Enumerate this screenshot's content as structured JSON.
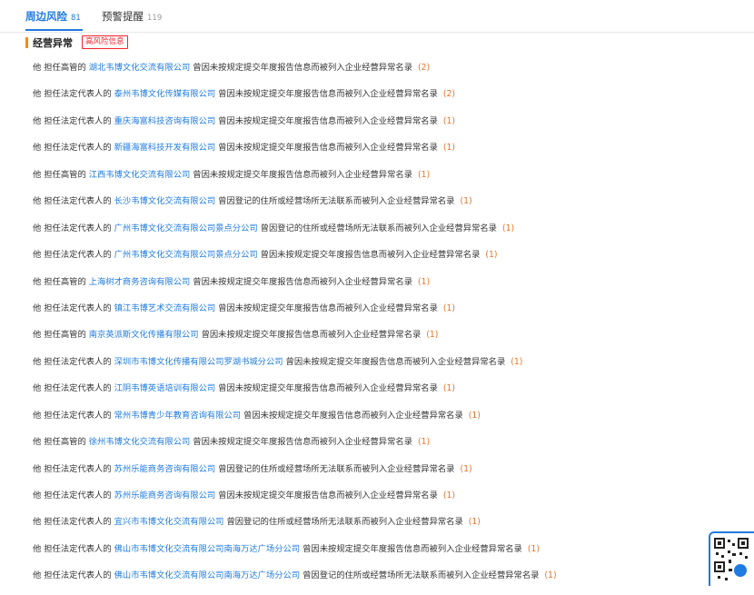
{
  "tabs": [
    {
      "label": "周边风险",
      "count": "81"
    },
    {
      "label": "预警提醒",
      "count": "119"
    }
  ],
  "section": {
    "title": "经营异常",
    "badge": "高风险信息"
  },
  "items": [
    {
      "prefix": "他 担任高管的",
      "company": "湖北韦博文化交流有限公司",
      "desc": "曾因未按规定提交年度报告信息而被列入企业经营异常名录",
      "count": "(2)"
    },
    {
      "prefix": "他 担任法定代表人的",
      "company": "泰州韦博文化传媒有限公司",
      "desc": "曾因未按规定提交年度报告信息而被列入企业经营异常名录",
      "count": "(2)"
    },
    {
      "prefix": "他 担任法定代表人的",
      "company": "重庆海富科技咨询有限公司",
      "desc": "曾因未按规定提交年度报告信息而被列入企业经营异常名录",
      "count": "(1)"
    },
    {
      "prefix": "他 担任法定代表人的",
      "company": "新疆海富科技开发有限公司",
      "desc": "曾因未按规定提交年度报告信息而被列入企业经营异常名录",
      "count": "(1)"
    },
    {
      "prefix": "他 担任高管的",
      "company": "江西韦博文化交流有限公司",
      "desc": "曾因未按规定提交年度报告信息而被列入企业经营异常名录",
      "count": "(1)"
    },
    {
      "prefix": "他 担任法定代表人的",
      "company": "长沙韦博文化交流有限公司",
      "desc": "曾因登记的住所或经营场所无法联系而被列入企业经营异常名录",
      "count": "(1)"
    },
    {
      "prefix": "他 担任法定代表人的",
      "company": "广州韦博文化交流有限公司景点分公司",
      "desc": "曾因登记的住所或经营场所无法联系而被列入企业经营异常名录",
      "count": "(1)"
    },
    {
      "prefix": "他 担任法定代表人的",
      "company": "广州韦博文化交流有限公司景点分公司",
      "desc": "曾因未按规定提交年度报告信息而被列入企业经营异常名录",
      "count": "(1)"
    },
    {
      "prefix": "他 担任高管的",
      "company": "上海树才商务咨询有限公司",
      "desc": "曾因未按规定提交年度报告信息而被列入企业经营异常名录",
      "count": "(1)"
    },
    {
      "prefix": "他 担任法定代表人的",
      "company": "镇江韦博艺术交流有限公司",
      "desc": "曾因未按规定提交年度报告信息而被列入企业经营异常名录",
      "count": "(1)"
    },
    {
      "prefix": "他 担任高管的",
      "company": "南京英派斯文化传播有限公司",
      "desc": "曾因未按规定提交年度报告信息而被列入企业经营异常名录",
      "count": "(1)"
    },
    {
      "prefix": "他 担任法定代表人的",
      "company": "深圳市韦博文化传播有限公司罗湖书城分公司",
      "desc": "曾因未按规定提交年度报告信息而被列入企业经营异常名录",
      "count": "(1)"
    },
    {
      "prefix": "他 担任法定代表人的",
      "company": "江阴韦博英语培训有限公司",
      "desc": "曾因未按规定提交年度报告信息而被列入企业经营异常名录",
      "count": "(1)"
    },
    {
      "prefix": "他 担任法定代表人的",
      "company": "常州韦博青少年教育咨询有限公司",
      "desc": "曾因未按规定提交年度报告信息而被列入企业经营异常名录",
      "count": "(1)"
    },
    {
      "prefix": "他 担任高管的",
      "company": "徐州韦博文化交流有限公司",
      "desc": "曾因未按规定提交年度报告信息而被列入企业经营异常名录",
      "count": "(1)"
    },
    {
      "prefix": "他 担任法定代表人的",
      "company": "苏州乐能商务咨询有限公司",
      "desc": "曾因登记的住所或经营场所无法联系而被列入企业经营异常名录",
      "count": "(1)"
    },
    {
      "prefix": "他 担任法定代表人的",
      "company": "苏州乐能商务咨询有限公司",
      "desc": "曾因未按规定提交年度报告信息而被列入企业经营异常名录",
      "count": "(1)"
    },
    {
      "prefix": "他 担任法定代表人的",
      "company": "宜兴市韦博文化交流有限公司",
      "desc": "曾因登记的住所或经营场所无法联系而被列入企业经营异常名录",
      "count": "(1)"
    },
    {
      "prefix": "他 担任法定代表人的",
      "company": "佛山市韦博文化交流有限公司南海万达广场分公司",
      "desc": "曾因未按规定提交年度报告信息而被列入企业经营异常名录",
      "count": "(1)"
    },
    {
      "prefix": "他 担任法定代表人的",
      "company": "佛山市韦博文化交流有限公司南海万达广场分公司",
      "desc": "曾因登记的住所或经营场所无法联系而被列入企业经营异常名录",
      "count": "(1)"
    }
  ],
  "widgets": {
    "qr_icon": "qr-code-icon",
    "accent": "#1f7be0",
    "warning": "#f5222d"
  }
}
